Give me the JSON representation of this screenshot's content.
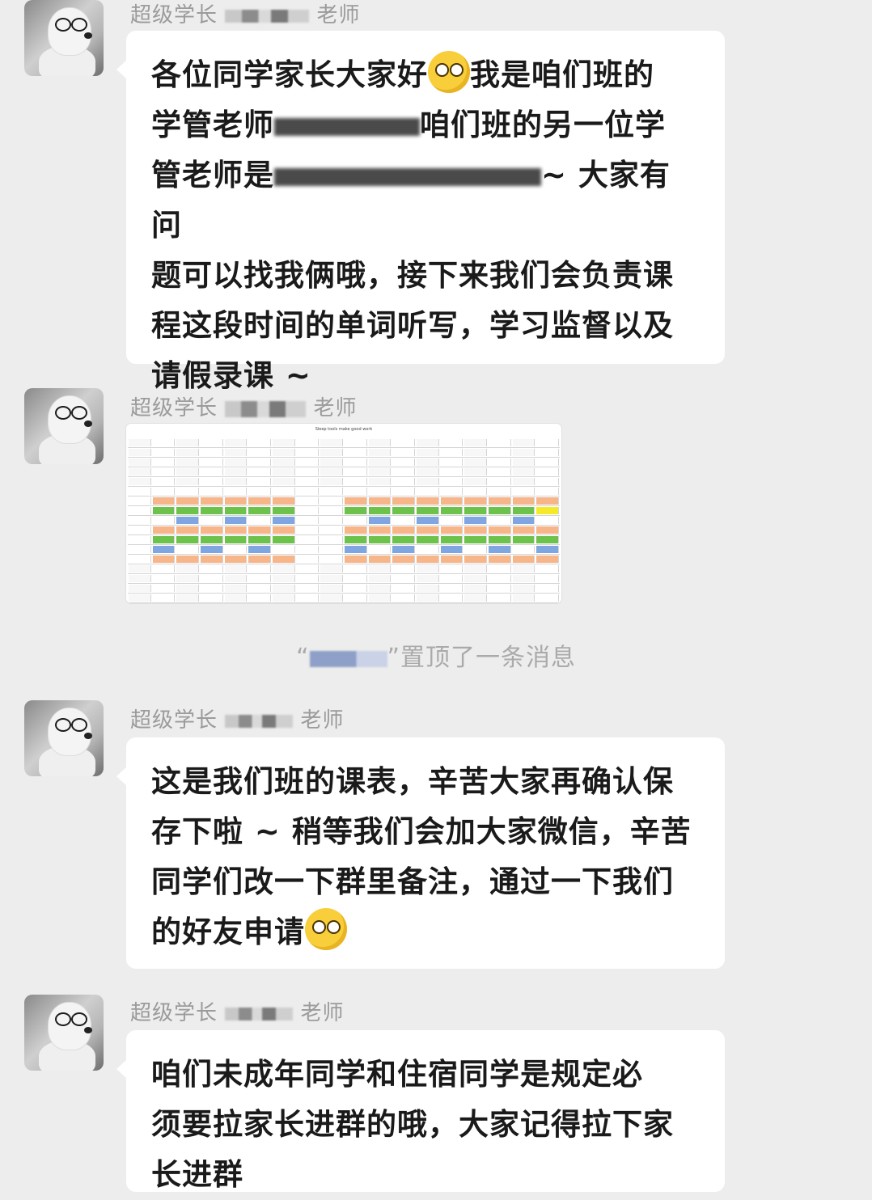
{
  "messages": [
    {
      "sender_prefix": "超级学长",
      "sender_suffix": "老师",
      "type": "text",
      "lines": [
        {
          "pre": "各位同学家长大家好",
          "emoji": "emoji-smirk",
          "post": "我是咱们班的"
        },
        {
          "pre": "学管老师",
          "post": "咱们班的另一位学"
        },
        {
          "pre": "管老师是",
          "post": "~ 大家有问"
        },
        {
          "pre": "题可以找我俩哦，接下来我们会负责课"
        },
        {
          "pre": "程这段时间的单词听写，学习监督以及"
        },
        {
          "pre": "请假录课 ~"
        }
      ]
    },
    {
      "sender_prefix": "超级学长",
      "sender_suffix": "老师",
      "type": "image",
      "image_desc": "class-schedule-table",
      "schedule_title": "Sleep tools make good work"
    },
    {
      "sender_prefix": "超级学长",
      "sender_suffix": "老师",
      "type": "text",
      "lines": [
        {
          "pre": "这是我们班的课表，辛苦大家再确认保"
        },
        {
          "pre": "存下啦 ~ 稍等我们会加大家微信，辛苦"
        },
        {
          "pre": "同学们改一下群里备注，通过一下我们"
        },
        {
          "pre": "的好友申请",
          "emoji": "emoji-smirk"
        }
      ]
    },
    {
      "sender_prefix": "超级学长",
      "sender_suffix": "老师",
      "type": "text",
      "lines": [
        {
          "pre": "咱们未成年同学和住宿同学是规定必"
        },
        {
          "pre": "须要拉家长进群的哦，大家记得拉下家"
        },
        {
          "pre": "长进群"
        }
      ]
    }
  ],
  "system_notice": {
    "open_quote": "“",
    "text": "”置顶了一条消息"
  },
  "colors": {
    "background": "#ededed",
    "bubble": "#ffffff",
    "sender": "#9b9b9b",
    "text": "#1a1a1a",
    "schedule_orange": "#f7b58a",
    "schedule_green": "#6cc24a",
    "schedule_blue": "#7fa6e0",
    "schedule_yellow": "#f5ea2a"
  }
}
